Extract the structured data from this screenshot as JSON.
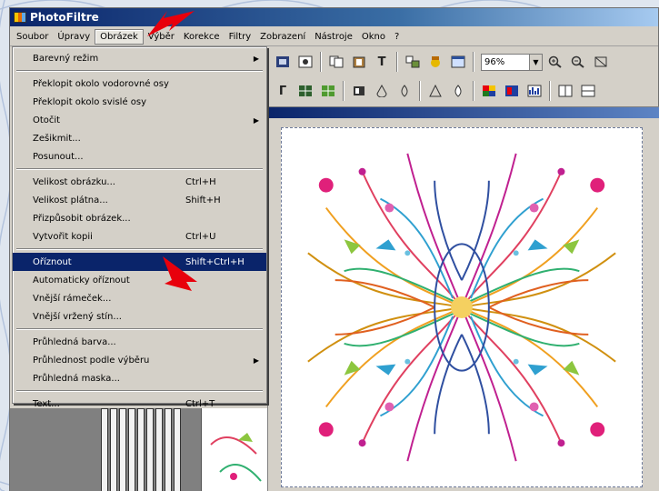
{
  "window": {
    "title": "PhotoFiltre"
  },
  "menubar": {
    "items": [
      "Soubor",
      "Úpravy",
      "Obrázek",
      "Výběr",
      "Korekce",
      "Filtry",
      "Zobrazení",
      "Nástroje",
      "Okno",
      "?"
    ],
    "active_index": 2
  },
  "dropdown": {
    "groups": [
      [
        {
          "label": "Barevný režim",
          "submenu": true
        }
      ],
      [
        {
          "label": "Překlopit okolo vodorovné osy"
        },
        {
          "label": "Překlopit okolo svislé osy"
        },
        {
          "label": "Otočit",
          "submenu": true
        },
        {
          "label": "Zešikmit..."
        },
        {
          "label": "Posunout..."
        }
      ],
      [
        {
          "label": "Velikost obrázku...",
          "shortcut": "Ctrl+H"
        },
        {
          "label": "Velikost plátna...",
          "shortcut": "Shift+H"
        },
        {
          "label": "Přizpůsobit obrázek..."
        },
        {
          "label": "Vytvořit kopii",
          "shortcut": "Ctrl+U"
        }
      ],
      [
        {
          "label": "Oříznout",
          "shortcut": "Shift+Ctrl+H",
          "selected": true
        },
        {
          "label": "Automaticky oříznout"
        },
        {
          "label": "Vnější rámeček..."
        },
        {
          "label": "Vnější vržený stín..."
        }
      ],
      [
        {
          "label": "Průhledná barva..."
        },
        {
          "label": "Průhlednost podle výběru",
          "submenu": true
        },
        {
          "label": "Průhledná maska..."
        }
      ],
      [
        {
          "label": "Text...",
          "shortcut": "Ctrl+T"
        }
      ]
    ]
  },
  "toolbar": {
    "zoom_value": "96%"
  },
  "icons": {
    "toolbar1": [
      "image-icon",
      "layers-icon",
      "copy-icon",
      "paste-icon",
      "text-icon",
      "clone-icon",
      "hand-icon",
      "window-icon",
      "zoom-in-icon",
      "zoom-out-icon",
      "fit-icon"
    ],
    "toolbar2": [
      "gamma-icon",
      "grid-icon",
      "grid-green-icon",
      "levels-icon",
      "drop-icon",
      "drop-outline-icon",
      "triangle-icon",
      "drop-blue-icon",
      "palette-icon",
      "rgb-icon",
      "histogram-icon",
      "panel-icon",
      "panel-b-icon"
    ]
  },
  "colors": {
    "selection": "#0a246a",
    "arrow": "#e8000c",
    "canvas_border": "#6d7a9a"
  }
}
